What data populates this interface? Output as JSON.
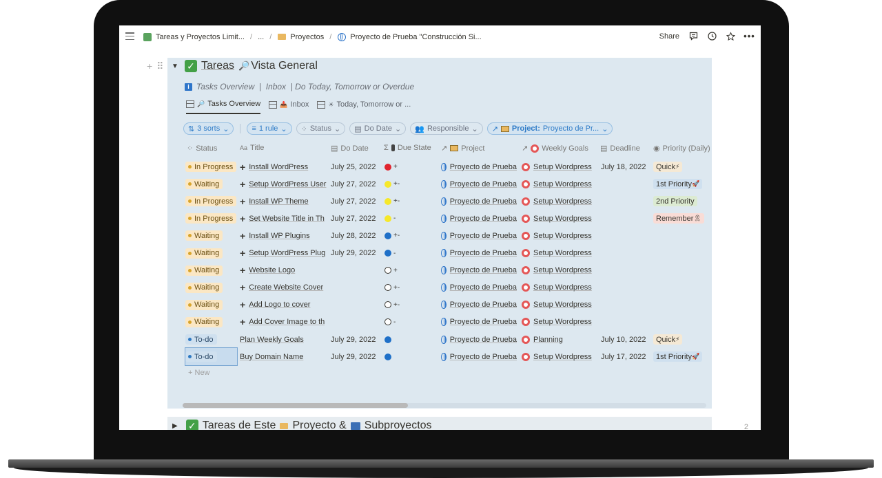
{
  "topbar": {
    "crumbs": [
      "Tareas y Proyectos Limit...",
      "...",
      "Proyectos",
      "Proyecto de Prueba \"Construcción Si..."
    ],
    "share_label": "Share"
  },
  "database": {
    "title": "Tareas",
    "title_suffix": "Vista General",
    "description": "Tasks Overview  |  Inbox  | Do Today, Tomorrow or Overdue",
    "tabs": [
      {
        "label": "Tasks Overview"
      },
      {
        "label": "Inbox"
      },
      {
        "label": "Today, Tomorrow or ..."
      }
    ],
    "filters": {
      "sorts": "3 sorts",
      "rule": "1 rule",
      "status": "Status",
      "do_date": "Do Date",
      "responsible": "Responsible",
      "project_label": "Project:",
      "project_value": "Proyecto de Pr..."
    },
    "columns": [
      "Status",
      "Title",
      "Do Date",
      "Due State",
      "Project",
      "Weekly Goals",
      "Deadline",
      "Priority (Daily)"
    ],
    "rows": [
      {
        "status": "In Progress",
        "title": "Install WordPress",
        "do_date": "July 25, 2022",
        "due_color": "#e0242e",
        "due_suffix": "+",
        "project": "Proyecto de Prueba",
        "goal": "Setup Wordpress",
        "deadline": "July 18, 2022",
        "priority": "Quick"
      },
      {
        "status": "Waiting",
        "title": "Setup WordPress User",
        "do_date": "July 27, 2022",
        "due_color": "#f6e82a",
        "due_suffix": "+-",
        "project": "Proyecto de Prueba",
        "goal": "Setup Wordpress",
        "deadline": "",
        "priority": "1st Priority"
      },
      {
        "status": "In Progress",
        "title": "Install WP Theme",
        "do_date": "July 27, 2022",
        "due_color": "#f6e82a",
        "due_suffix": "+-",
        "project": "Proyecto de Prueba",
        "goal": "Setup Wordpress",
        "deadline": "",
        "priority": "2nd Priority"
      },
      {
        "status": "In Progress",
        "title": "Set Website Title in Th",
        "do_date": "July 27, 2022",
        "due_color": "#f6e82a",
        "due_suffix": "-",
        "project": "Proyecto de Prueba",
        "goal": "Setup Wordpress",
        "deadline": "",
        "priority": "Remember"
      },
      {
        "status": "Waiting",
        "title": "Install WP Plugins",
        "do_date": "July 28, 2022",
        "due_color": "#1f70c8",
        "due_suffix": "+-",
        "project": "Proyecto de Prueba",
        "goal": "Setup Wordpress",
        "deadline": "",
        "priority": ""
      },
      {
        "status": "Waiting",
        "title": "Setup WordPress Plug",
        "do_date": "July 29, 2022",
        "due_color": "#1f70c8",
        "due_suffix": "-",
        "project": "Proyecto de Prueba",
        "goal": "Setup Wordpress",
        "deadline": "",
        "priority": ""
      },
      {
        "status": "Waiting",
        "title": "Website Logo",
        "do_date": "",
        "due_color": "#ffffff",
        "due_suffix": "+",
        "project": "Proyecto de Prueba",
        "goal": "Setup Wordpress",
        "deadline": "",
        "priority": ""
      },
      {
        "status": "Waiting",
        "title": "Create Website Cover",
        "do_date": "",
        "due_color": "#ffffff",
        "due_suffix": "+-",
        "project": "Proyecto de Prueba",
        "goal": "Setup Wordpress",
        "deadline": "",
        "priority": ""
      },
      {
        "status": "Waiting",
        "title": "Add Logo to cover",
        "do_date": "",
        "due_color": "#ffffff",
        "due_suffix": "+-",
        "project": "Proyecto de Prueba",
        "goal": "Setup Wordpress",
        "deadline": "",
        "priority": ""
      },
      {
        "status": "Waiting",
        "title": "Add Cover Image to th",
        "do_date": "",
        "due_color": "#ffffff",
        "due_suffix": "-",
        "project": "Proyecto de Prueba",
        "goal": "Setup Wordpress",
        "deadline": "",
        "priority": ""
      },
      {
        "status": "To-do",
        "title": "Plan Weekly Goals",
        "do_date": "July 29, 2022",
        "due_color": "#1f70c8",
        "due_suffix": "",
        "project": "Proyecto de Prueba",
        "goal": "Planning",
        "deadline": "July 10, 2022",
        "priority": "Quick"
      },
      {
        "status": "To-do",
        "title": "Buy Domain Name",
        "do_date": "July 29, 2022",
        "due_color": "#1f70c8",
        "due_suffix": "",
        "project": "Proyecto de Prueba",
        "goal": "Setup Wordpress",
        "deadline": "July 17, 2022",
        "priority": "1st Priority"
      }
    ],
    "new_label": "New"
  },
  "second_block": {
    "title_a": "Tareas de Este",
    "title_b": "Proyecto &",
    "title_c": "Subproyectos",
    "page_num": "2"
  },
  "colors": {
    "waiting_bg": "#fbe7c4",
    "todo_bg": "#cfe0ef",
    "quick_bg": "#f5e9d5",
    "first_priority_bg": "#cfe0ef",
    "second_priority_bg": "#dcebd2",
    "remember_bg": "#f9dcd6"
  }
}
